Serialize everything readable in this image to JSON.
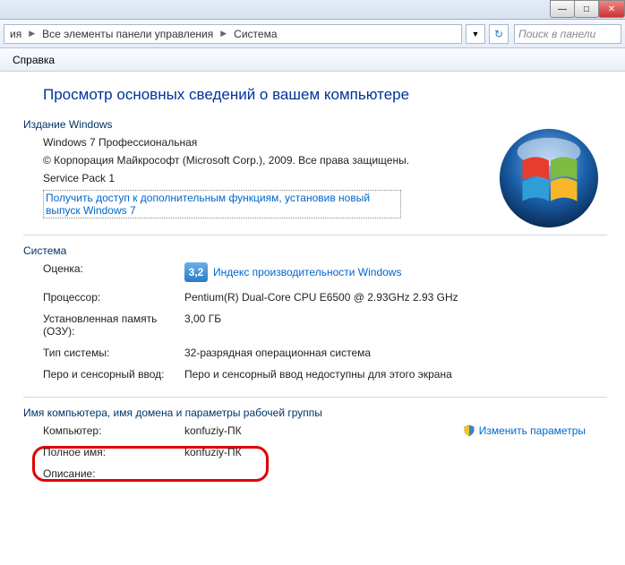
{
  "titlebar": {
    "minimize": "—",
    "maximize": "□",
    "close": "✕"
  },
  "address": {
    "crumb1": "ия",
    "crumb2": "Все элементы панели управления",
    "crumb3": "Система",
    "search_ph": "Поиск в панели"
  },
  "menu": {
    "help": "Справка"
  },
  "main": {
    "heading": "Просмотр основных сведений о вашем компьютере",
    "edition_title": "Издание Windows",
    "edition_name": "Windows 7 Профессиональная",
    "copyright": "© Корпорация Майкрософт (Microsoft Corp.), 2009. Все права защищены.",
    "sp": "Service Pack 1",
    "upgrade_link": "Получить доступ к дополнительным функциям, установив новый выпуск Windows 7"
  },
  "system": {
    "title": "Система",
    "rating_label": "Оценка:",
    "rating_value": "3,2",
    "rating_link": "Индекс производительности Windows",
    "cpu_label": "Процессор:",
    "cpu_value": "Pentium(R) Dual-Core  CPU     E6500  @ 2.93GHz   2.93 GHz",
    "ram_label": "Установленная память (ОЗУ):",
    "ram_value": "3,00 ГБ",
    "type_label": "Тип системы:",
    "type_value": "32-разрядная операционная система",
    "pen_label": "Перо и сенсорный ввод:",
    "pen_value": "Перо и сенсорный ввод недоступны для этого экрана"
  },
  "domain": {
    "title": "Имя компьютера, имя домена и параметры рабочей группы",
    "computer_label": "Компьютер:",
    "computer_value": "konfuziy-ПК",
    "fullname_label": "Полное имя:",
    "fullname_value": "konfuziy-ПК",
    "desc_label": "Описание:",
    "change_link": "Изменить параметры"
  }
}
